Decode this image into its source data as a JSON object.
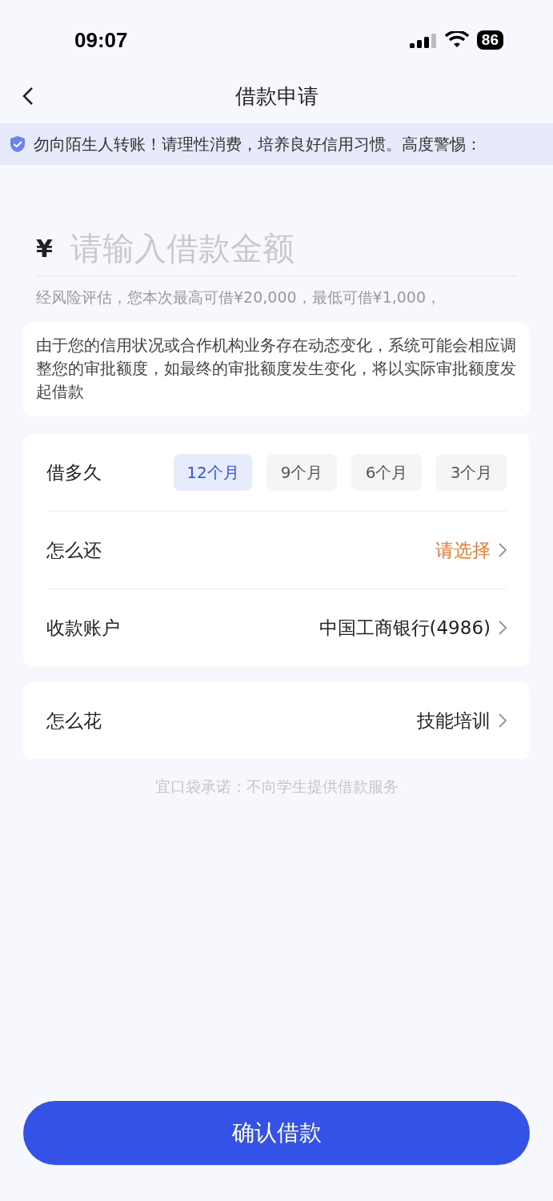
{
  "status_bar": {
    "time": "09:07",
    "battery": "86"
  },
  "nav": {
    "title": "借款申请"
  },
  "notice": {
    "text": "勿向陌生人转账！请理性消费，培养良好信用习惯。高度警惕："
  },
  "amount": {
    "currency": "¥",
    "placeholder": "请输入借款金额",
    "hint": "经风险评估，您本次最高可借¥20,000，最低可借¥1,000，"
  },
  "disclaimer": "由于您的信用状况或合作机构业务存在动态变化，系统可能会相应调整您的审批额度，如最终的审批额度发生变化，将以实际审批额度发起借款",
  "term": {
    "label": "借多久",
    "options": [
      {
        "label": "12个月",
        "selected": true
      },
      {
        "label": "9个月",
        "selected": false
      },
      {
        "label": "6个月",
        "selected": false
      },
      {
        "label": "3个月",
        "selected": false
      }
    ]
  },
  "rows": [
    {
      "label": "怎么还",
      "value": "请选择",
      "kind": "prompt"
    },
    {
      "label": "收款账户",
      "value": "中国工商银行(4986)",
      "kind": "value"
    }
  ],
  "purpose": {
    "label": "怎么花",
    "value": "技能培训"
  },
  "promise": "宜口袋承诺：不向学生提供借款服务",
  "confirm": "确认借款"
}
